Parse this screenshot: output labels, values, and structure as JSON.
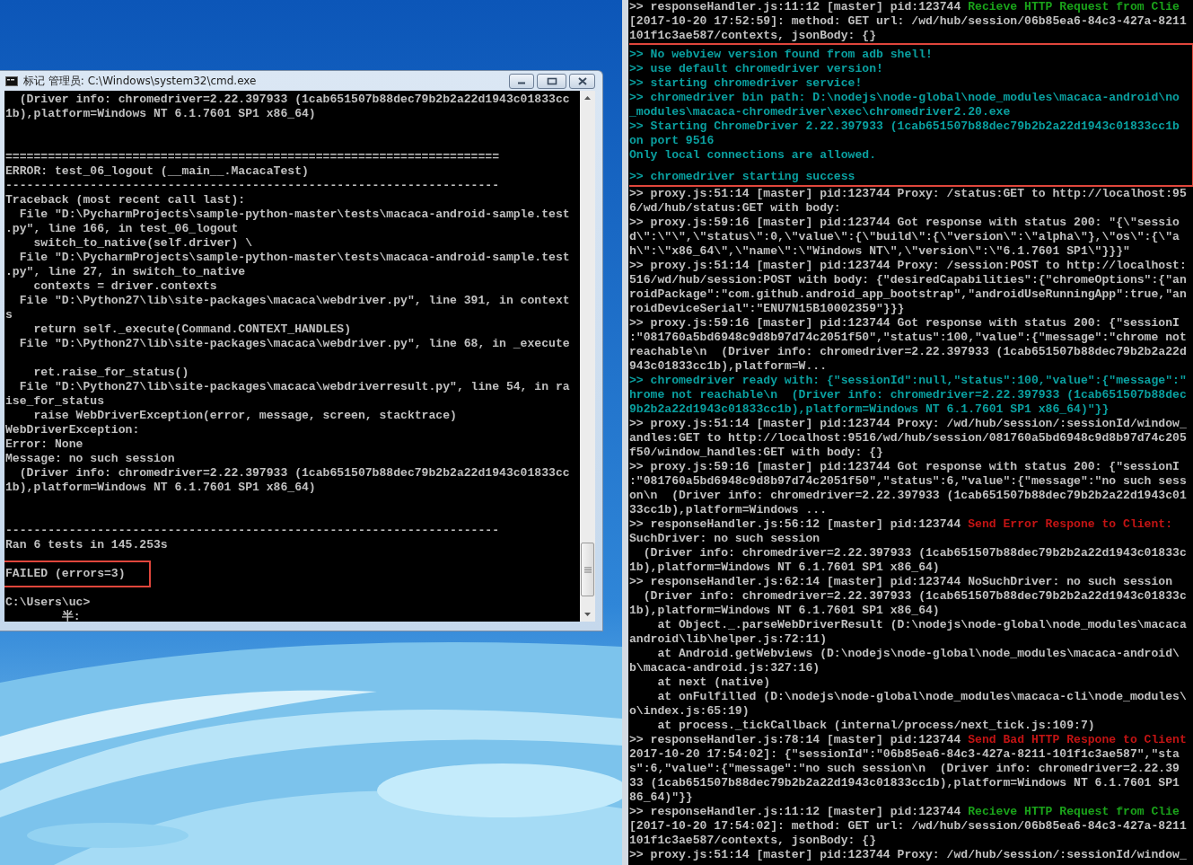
{
  "cmd_window": {
    "title": "标记 管理员: C:\\Windows\\system32\\cmd.exe",
    "lines": [
      {
        "kind": "text",
        "text": "  (Driver info: chromedriver=2.22.397933 (1cab651507b88dec79b2b2a22d1943c01833cc"
      },
      {
        "kind": "text",
        "text": "1b),platform=Windows NT 6.1.7601 SP1 x86_64)"
      },
      {
        "kind": "blank"
      },
      {
        "kind": "blank"
      },
      {
        "kind": "text",
        "text": "======================================================================"
      },
      {
        "kind": "text",
        "text": "ERROR: test_06_logout (__main__.MacacaTest)"
      },
      {
        "kind": "text",
        "text": "----------------------------------------------------------------------"
      },
      {
        "kind": "text",
        "text": "Traceback (most recent call last):"
      },
      {
        "kind": "text",
        "text": "  File \"D:\\PycharmProjects\\sample-python-master\\tests\\macaca-android-sample.test"
      },
      {
        "kind": "text",
        "text": ".py\", line 166, in test_06_logout"
      },
      {
        "kind": "text",
        "text": "    switch_to_native(self.driver) \\"
      },
      {
        "kind": "text",
        "text": "  File \"D:\\PycharmProjects\\sample-python-master\\tests\\macaca-android-sample.test"
      },
      {
        "kind": "text",
        "text": ".py\", line 27, in switch_to_native"
      },
      {
        "kind": "text",
        "text": "    contexts = driver.contexts"
      },
      {
        "kind": "text",
        "text": "  File \"D:\\Python27\\lib\\site-packages\\macaca\\webdriver.py\", line 391, in context"
      },
      {
        "kind": "text",
        "text": "s"
      },
      {
        "kind": "text",
        "text": "    return self._execute(Command.CONTEXT_HANDLES)"
      },
      {
        "kind": "text",
        "text": "  File \"D:\\Python27\\lib\\site-packages\\macaca\\webdriver.py\", line 68, in _execute"
      },
      {
        "kind": "blank"
      },
      {
        "kind": "text",
        "text": "    ret.raise_for_status()"
      },
      {
        "kind": "text",
        "text": "  File \"D:\\Python27\\lib\\site-packages\\macaca\\webdriverresult.py\", line 54, in ra"
      },
      {
        "kind": "text",
        "text": "ise_for_status"
      },
      {
        "kind": "text",
        "text": "    raise WebDriverException(error, message, screen, stacktrace)"
      },
      {
        "kind": "text",
        "text": "WebDriverException:"
      },
      {
        "kind": "text",
        "text": "Error: None"
      },
      {
        "kind": "text",
        "text": "Message: no such session"
      },
      {
        "kind": "text",
        "text": "  (Driver info: chromedriver=2.22.397933 (1cab651507b88dec79b2b2a22d1943c01833cc"
      },
      {
        "kind": "text",
        "text": "1b),platform=Windows NT 6.1.7601 SP1 x86_64)"
      },
      {
        "kind": "blank"
      },
      {
        "kind": "blank"
      },
      {
        "kind": "text",
        "text": "----------------------------------------------------------------------"
      },
      {
        "kind": "text",
        "text": "Ran 6 tests in 145.253s"
      },
      {
        "kind": "blank"
      },
      {
        "kind": "framed",
        "text": "FAILED (errors=3)"
      },
      {
        "kind": "blank"
      },
      {
        "kind": "text",
        "text": "C:\\Users\\uc>"
      },
      {
        "kind": "text",
        "text": "        半:"
      }
    ]
  },
  "log_console": {
    "blocks": [
      {
        "framed": false,
        "lines": [
          {
            "kind": "mixed",
            "segments": [
              {
                "text": ">> responseHandler.js:11:12 [master] pid:123744 "
              },
              {
                "text": "Recieve HTTP Request from Clie",
                "color": "#1aa31a"
              }
            ]
          },
          {
            "kind": "text",
            "text": "[2017-10-20 17:52:59]: method: GET url: /wd/hub/session/06b85ea6-84c3-427a-8211"
          },
          {
            "kind": "text",
            "text": "101f1c3ae587/contexts, jsonBody: {}"
          }
        ]
      },
      {
        "framed": true,
        "lines": [
          {
            "kind": "mixed",
            "segments": [
              {
                "text": ">> No webview version found from adb shell!",
                "color": "#0aa0a0"
              }
            ]
          },
          {
            "kind": "mixed",
            "segments": [
              {
                "text": ">> use default chromedriver version!",
                "color": "#0aa0a0"
              }
            ]
          },
          {
            "kind": "mixed",
            "segments": [
              {
                "text": ">> starting chromedriver service!",
                "color": "#0aa0a0"
              }
            ]
          },
          {
            "kind": "mixed",
            "segments": [
              {
                "text": ">> chromedriver bin path: D:\\nodejs\\node-global\\node_modules\\macaca-android\\no",
                "color": "#0aa0a0"
              }
            ]
          },
          {
            "kind": "mixed",
            "segments": [
              {
                "text": "_modules\\macaca-chromedriver\\exec\\chromedriver2.20.exe",
                "color": "#0aa0a0"
              }
            ]
          },
          {
            "kind": "mixed",
            "segments": [
              {
                "text": ">> Starting ChromeDriver 2.22.397933 (1cab651507b88dec79b2b2a22d1943c01833cc1b",
                "color": "#0aa0a0"
              }
            ]
          },
          {
            "kind": "mixed",
            "segments": [
              {
                "text": "on port 9516",
                "color": "#0aa0a0"
              }
            ]
          },
          {
            "kind": "mixed",
            "segments": [
              {
                "text": "Only local connections are allowed.",
                "color": "#0aa0a0"
              }
            ]
          },
          {
            "kind": "blank"
          },
          {
            "kind": "mixed",
            "segments": [
              {
                "text": ">> chromedriver starting success",
                "color": "#0aa0a0"
              }
            ]
          }
        ]
      },
      {
        "framed": false,
        "lines": [
          {
            "kind": "text",
            "text": ">> proxy.js:51:14 [master] pid:123744 Proxy: /status:GET to http://localhost:95"
          },
          {
            "kind": "text",
            "text": "6/wd/hub/status:GET with body:"
          },
          {
            "kind": "text",
            "text": ">> proxy.js:59:16 [master] pid:123744 Got response with status 200: \"{\\\"sessio"
          },
          {
            "kind": "text",
            "text": "d\\\":\\\"\\\",\\\"status\\\":0,\\\"value\\\":{\\\"build\\\":{\\\"version\\\":\\\"alpha\\\"},\\\"os\\\":{\\\"a"
          },
          {
            "kind": "text",
            "text": "h\\\":\\\"x86_64\\\",\\\"name\\\":\\\"Windows NT\\\",\\\"version\\\":\\\"6.1.7601 SP1\\\"}}}\""
          },
          {
            "kind": "text",
            "text": ">> proxy.js:51:14 [master] pid:123744 Proxy: /session:POST to http://localhost:"
          },
          {
            "kind": "text",
            "text": "516/wd/hub/session:POST with body: {\"desiredCapabilities\":{\"chromeOptions\":{\"an"
          },
          {
            "kind": "text",
            "text": "roidPackage\":\"com.github.android_app_bootstrap\",\"androidUseRunningApp\":true,\"an"
          },
          {
            "kind": "text",
            "text": "roidDeviceSerial\":\"ENU7N15B10002359\"}}}"
          },
          {
            "kind": "text",
            "text": ">> proxy.js:59:16 [master] pid:123744 Got response with status 200: {\"sessionI"
          },
          {
            "kind": "text",
            "text": ":\"081760a5bd6948c9d8b97d74c2051f50\",\"status\":100,\"value\":{\"message\":\"chrome not"
          },
          {
            "kind": "text",
            "text": "reachable\\n  (Driver info: chromedriver=2.22.397933 (1cab651507b88dec79b2b2a22d"
          },
          {
            "kind": "text",
            "text": "943c01833cc1b),platform=W..."
          },
          {
            "kind": "mixed",
            "segments": [
              {
                "text": ">> chromedriver ready with: {\"sessionId\":null,\"status\":100,\"value\":{\"message\":\"",
                "color": "#0aa0a0"
              }
            ]
          },
          {
            "kind": "mixed",
            "segments": [
              {
                "text": "hrome not reachable\\n  (Driver info: chromedriver=2.22.397933 (1cab651507b88dec",
                "color": "#0aa0a0"
              }
            ]
          },
          {
            "kind": "mixed",
            "segments": [
              {
                "text": "9b2b2a22d1943c01833cc1b),platform=Windows NT 6.1.7601 SP1 x86_64)\"}}",
                "color": "#0aa0a0"
              }
            ]
          },
          {
            "kind": "text",
            "text": ">> proxy.js:51:14 [master] pid:123744 Proxy: /wd/hub/session/:sessionId/window_"
          },
          {
            "kind": "text",
            "text": "andles:GET to http://localhost:9516/wd/hub/session/081760a5bd6948c9d8b97d74c205"
          },
          {
            "kind": "text",
            "text": "f50/window_handles:GET with body: {}"
          },
          {
            "kind": "text",
            "text": ">> proxy.js:59:16 [master] pid:123744 Got response with status 200: {\"sessionI"
          },
          {
            "kind": "text",
            "text": ":\"081760a5bd6948c9d8b97d74c2051f50\",\"status\":6,\"value\":{\"message\":\"no such sess"
          },
          {
            "kind": "text",
            "text": "on\\n  (Driver info: chromedriver=2.22.397933 (1cab651507b88dec79b2b2a22d1943c01"
          },
          {
            "kind": "text",
            "text": "33cc1b),platform=Windows ..."
          },
          {
            "kind": "mixed",
            "segments": [
              {
                "text": ">> responseHandler.js:56:12 [master] pid:123744 "
              },
              {
                "text": "Send Error Respone to Client:",
                "color": "#c41414"
              }
            ]
          },
          {
            "kind": "text",
            "text": "SuchDriver: no such session"
          },
          {
            "kind": "text",
            "text": "  (Driver info: chromedriver=2.22.397933 (1cab651507b88dec79b2b2a22d1943c01833c"
          },
          {
            "kind": "text",
            "text": "1b),platform=Windows NT 6.1.7601 SP1 x86_64)"
          },
          {
            "kind": "text",
            "text": ">> responseHandler.js:62:14 [master] pid:123744 NoSuchDriver: no such session"
          },
          {
            "kind": "text",
            "text": "  (Driver info: chromedriver=2.22.397933 (1cab651507b88dec79b2b2a22d1943c01833c"
          },
          {
            "kind": "text",
            "text": "1b),platform=Windows NT 6.1.7601 SP1 x86_64)"
          },
          {
            "kind": "text",
            "text": "    at Object._.parseWebDriverResult (D:\\nodejs\\node-global\\node_modules\\macaca"
          },
          {
            "kind": "text",
            "text": "android\\lib\\helper.js:72:11)"
          },
          {
            "kind": "text",
            "text": "    at Android.getWebviews (D:\\nodejs\\node-global\\node_modules\\macaca-android\\"
          },
          {
            "kind": "text",
            "text": "b\\macaca-android.js:327:16)"
          },
          {
            "kind": "text",
            "text": "    at next (native)"
          },
          {
            "kind": "text",
            "text": "    at onFulfilled (D:\\nodejs\\node-global\\node_modules\\macaca-cli\\node_modules\\"
          },
          {
            "kind": "text",
            "text": "o\\index.js:65:19)"
          },
          {
            "kind": "text",
            "text": "    at process._tickCallback (internal/process/next_tick.js:109:7)"
          },
          {
            "kind": "mixed",
            "segments": [
              {
                "text": ">> responseHandler.js:78:14 [master] pid:123744 "
              },
              {
                "text": "Send Bad HTTP Respone to Client",
                "color": "#c41414"
              }
            ]
          },
          {
            "kind": "text",
            "text": "2017-10-20 17:54:02]: {\"sessionId\":\"06b85ea6-84c3-427a-8211-101f1c3ae587\",\"sta"
          },
          {
            "kind": "text",
            "text": "s\":6,\"value\":{\"message\":\"no such session\\n  (Driver info: chromedriver=2.22.39"
          },
          {
            "kind": "text",
            "text": "33 (1cab651507b88dec79b2b2a22d1943c01833cc1b),platform=Windows NT 6.1.7601 SP1"
          },
          {
            "kind": "text",
            "text": "86_64)\"}}"
          },
          {
            "kind": "mixed",
            "segments": [
              {
                "text": ">> responseHandler.js:11:12 [master] pid:123744 "
              },
              {
                "text": "Recieve HTTP Request from Clie",
                "color": "#1aa31a"
              }
            ]
          },
          {
            "kind": "text",
            "text": "[2017-10-20 17:54:02]: method: GET url: /wd/hub/session/06b85ea6-84c3-427a-8211"
          },
          {
            "kind": "text",
            "text": "101f1c3ae587/contexts, jsonBody: {}"
          },
          {
            "kind": "text",
            "text": ">> proxy.js:51:14 [master] pid:123744 Proxy: /wd/hub/session/:sessionId/window_"
          }
        ]
      }
    ]
  }
}
